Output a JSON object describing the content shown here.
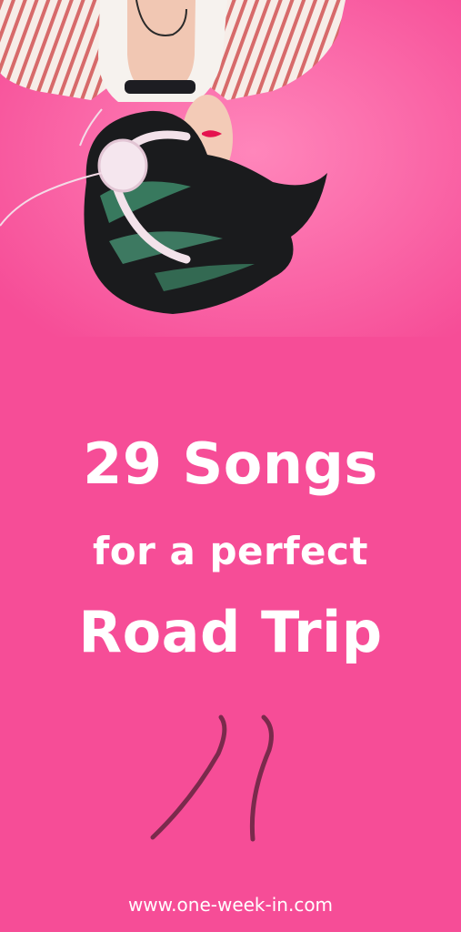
{
  "headline": {
    "line1": "29 Songs",
    "line2": "for a perfect",
    "line3": "Road Trip"
  },
  "footer": {
    "url": "www.one-week-in.com"
  },
  "colors": {
    "background": "#f64d97",
    "text": "#ffffff",
    "road_lines": "#7a2a4c"
  },
  "images": {
    "hero": "woman-lying-upside-down-with-headphones",
    "road": "road-line-drawing"
  }
}
